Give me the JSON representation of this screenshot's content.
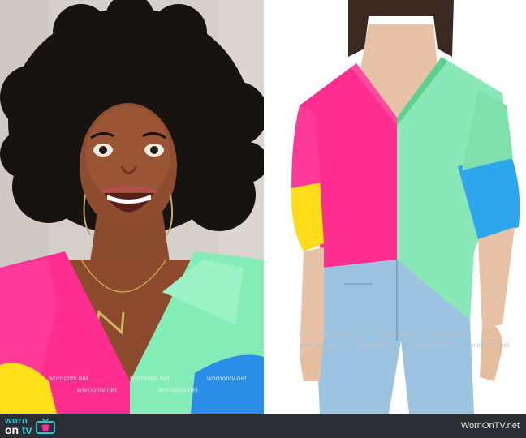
{
  "watermark_text": "wornontv.net",
  "footer": {
    "logo_top": "worn",
    "logo_on": "on",
    "logo_tv": "tv",
    "site_name": "WornOnTV.net"
  },
  "colors": {
    "pink": "#ff2d8f",
    "mint": "#7ee8b0",
    "yellow": "#ffe01a",
    "blue": "#2aa4ee",
    "denim": "#9cc3e0",
    "footer_bg": "#2b2f33",
    "logo_accent": "#2ec4d6"
  }
}
